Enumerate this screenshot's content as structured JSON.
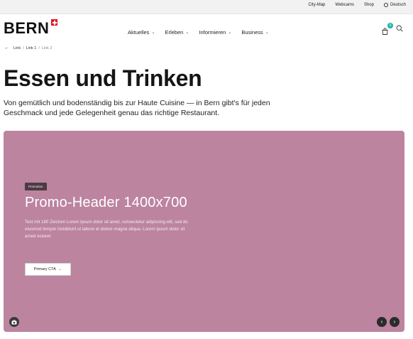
{
  "utility_nav": {
    "items": [
      "City-Map",
      "Webcams",
      "Shop",
      "Deutsch"
    ]
  },
  "logo": {
    "text": "BERN"
  },
  "main_nav": {
    "items": [
      "Aktuelles",
      "Erleben",
      "Informieren",
      "Business"
    ]
  },
  "cart": {
    "count": "0"
  },
  "breadcrumb": {
    "items": [
      "Link",
      "Link 1",
      "Link 2"
    ]
  },
  "page": {
    "title": "Essen und Trinken",
    "intro": "Von gemütlich und bodenständig bis zur Haute Cuisine — in Bern gibt's für jeden Geschmack und jede Gelegenheit genau das richtige Restaurant."
  },
  "hero": {
    "background_color": "#bc849f",
    "badge": "Promotion",
    "title": "Promo-Header 1400x700",
    "text": "Text mit 180 Zeichen Lorem ipsum dolor sit amet, consectetur adipiscing elit, sed do eiusmod tempor incididunt ut labore et dolore magna aliqua. Lorem ipsum dolor sit amed estaret.",
    "cta_label": "Primary CTA",
    "cta_arrow": "→"
  },
  "colors": {
    "badge_teal": "#1fb3a8",
    "swiss_red": "#e1192b"
  }
}
